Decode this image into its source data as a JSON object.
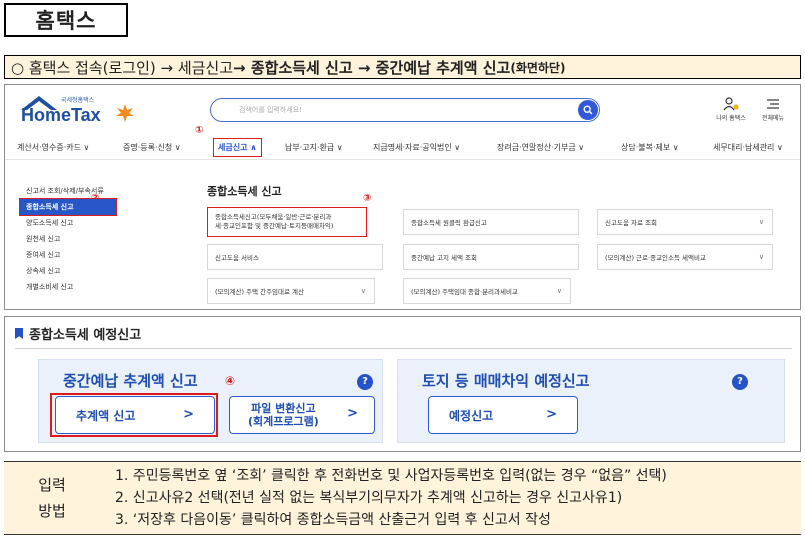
{
  "title": "홈택스",
  "route": {
    "prefix": "○ 홈택스 접속(로그인) → 세금신고 ",
    "bold": "→ 종합소득세 신고 → 중간예납 추계액 신고",
    "small": "(화면하단)"
  },
  "hometax": {
    "logo_sub": "국세청홈택스",
    "logo_name": "HomeTax",
    "search_placeholder": "검색어를 입력하세요!",
    "top_icons": [
      {
        "label": "나의 홈택스",
        "icon": "user-icon"
      },
      {
        "label": "전체메뉴",
        "icon": "menu-icon"
      }
    ],
    "gnb": [
      "계산서·영수증·카드 ∨",
      "증명·등록·신청 ∨",
      "세금신고 ∧",
      "납부·고지·환급 ∨",
      "지급명세·자료·공익법인 ∨",
      "장려금·연말정산·기부금 ∨",
      "상담·불복·제보 ∨",
      "세무대리·납세관리 ∨"
    ],
    "markers": [
      "①",
      "②",
      "③",
      "④"
    ],
    "left_menu": [
      "신고서 조회/삭제/부속서류",
      "종합소득세 신고",
      "양도소득세 신고",
      "원천세 신고",
      "증여세 신고",
      "상속세 신고",
      "개별소비세 신고"
    ],
    "sub_title": "종합소득세 신고",
    "cells": [
      "종합소득세신고(모두채움·일반·근로·분리과",
      "세·종교인포함 및 중간예납·토지등매매차익)",
      "종합소득세 원클릭 환급신고",
      "신고도움 자료 조회",
      "신고도움 서비스",
      "중간예납 고지 세액 조회",
      "(모의계산) 근로·종교인소득 세액비교",
      "(모의계산) 주택 간주임대료 계산",
      "(모의계산) 주택임대 종합·분리과세비교"
    ]
  },
  "section": {
    "heading": "종합소득세 예정신고",
    "panel1_title": "중간예납 추계액 신고",
    "panel1_btn1": "추계액 신고",
    "panel1_btn2_line1": "파일 변환신고",
    "panel1_btn2_line2": "(회계프로그램)",
    "panel2_title": "토지 등 매매차익 예정신고",
    "panel2_btn": "예정신고",
    "help": "?",
    "arrow": ">"
  },
  "instructions": {
    "label_line1": "입력",
    "label_line2": "방법",
    "lines": [
      "1. 주민등록번호 옆 ‘조회’ 클릭한 후 전화번호 및 사업자등록번호 입력(없는 경우 “없음” 선택)",
      "2. 신고사유2 선택(전년 실적 없는 복식부기의무자가 추계액 신고하는 경우 신고사유1)",
      "3. ‘저장후 다음이동’ 클릭하여 종합소득금액 산출근거 입력 후 신고서 작성"
    ]
  },
  "colors": {
    "accent_blue": "#2452c8",
    "highlight_red": "#e01a1a",
    "bg_cream": "#fff3dc",
    "panel_bg": "#ebf1fa"
  }
}
